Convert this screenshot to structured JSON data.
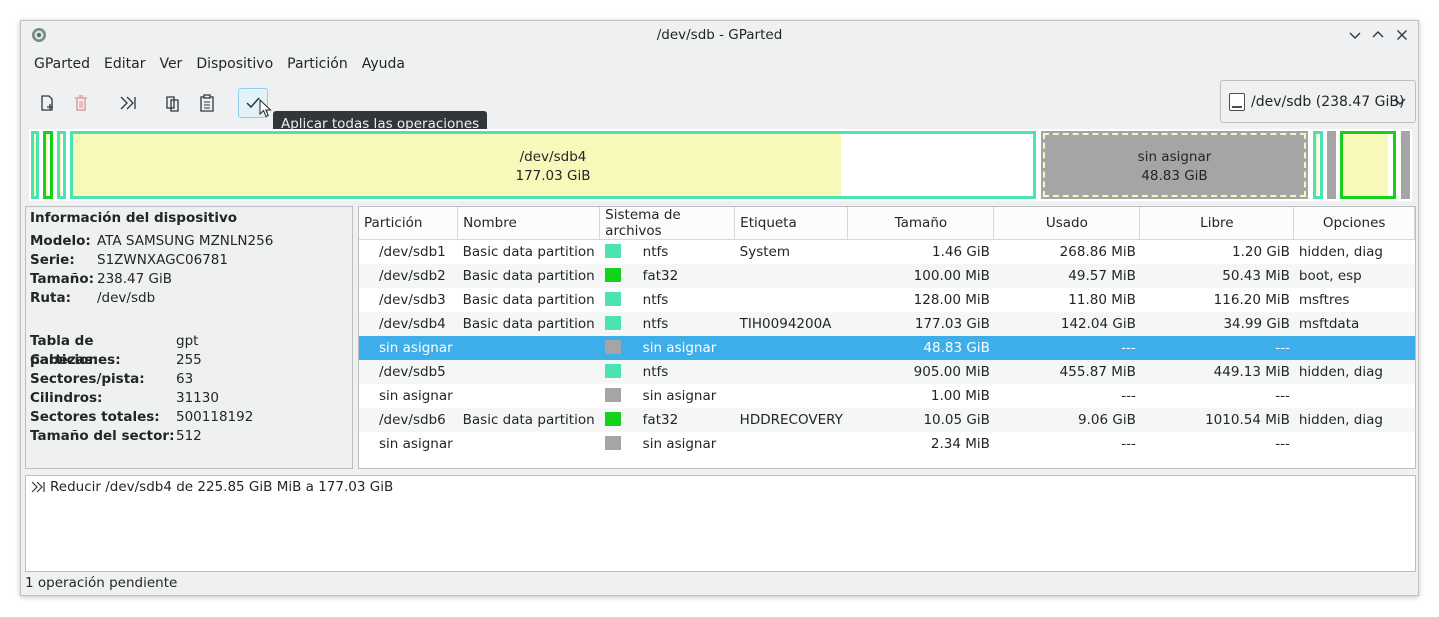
{
  "window": {
    "title": "/dev/sdb - GParted"
  },
  "menubar": [
    "GParted",
    "Editar",
    "Ver",
    "Dispositivo",
    "Partición",
    "Ayuda"
  ],
  "toolbar": {
    "buttons": [
      "new-icon",
      "delete-icon",
      "resize-move-icon",
      "copy-icon",
      "paste-icon",
      "apply-icon"
    ],
    "tooltip": "Aplicar todas las operaciones"
  },
  "device_selector": {
    "value": "/dev/sdb  (238.47 GiB)"
  },
  "disk_map": {
    "segments": [
      {
        "label": "",
        "fs": "ntfs",
        "used_fraction": 0.99,
        "border": "#4be3b0"
      },
      {
        "label": "",
        "fs": "fat32",
        "used_fraction": 0.5,
        "border": "#16d11a"
      },
      {
        "label": "",
        "fs": "ntfs",
        "used_fraction": 0.1,
        "border": "#4be3b0"
      },
      {
        "label": "/dev/sdb4",
        "size": "177.03 GiB",
        "fs": "ntfs",
        "used_fraction": 0.8,
        "border": "#4be3b0"
      },
      {
        "label": "sin asignar",
        "size": "48.83 GiB",
        "fs": "unallocated",
        "used_fraction": 1,
        "border": "#f8f8bb"
      },
      {
        "label": "",
        "fs": "ntfs",
        "used_fraction": 0.5,
        "border": "#4be3b0"
      },
      {
        "label": "",
        "fs": "unallocated",
        "used_fraction": 1,
        "border": "#a5a5a5"
      },
      {
        "label": "",
        "fs": "fat32",
        "used_fraction": 0.9,
        "border": "#16d11a"
      },
      {
        "label": "",
        "fs": "unallocated",
        "used_fraction": 1,
        "border": "#a5a5a5"
      }
    ]
  },
  "device_info": {
    "header": "Información del dispositivo",
    "rows1": [
      {
        "k": "Modelo:",
        "v": "ATA SAMSUNG MZNLN256"
      },
      {
        "k": "Serie:",
        "v": "S1ZWNXAGC06781"
      },
      {
        "k": "Tamaño:",
        "v": "238.47 GiB"
      },
      {
        "k": "Ruta:",
        "v": "/dev/sdb"
      }
    ],
    "rows2": [
      {
        "k": "Tabla de particiones:",
        "v": "gpt"
      },
      {
        "k": "Cabezas:",
        "v": "255"
      },
      {
        "k": "Sectores/pista:",
        "v": "63"
      },
      {
        "k": "Cilindros:",
        "v": "31130"
      },
      {
        "k": "Sectores totales:",
        "v": "500118192"
      },
      {
        "k": "Tamaño del sector:",
        "v": "512"
      }
    ]
  },
  "table": {
    "headers": [
      "Partición",
      "Nombre",
      "Sistema de archivos",
      "Etiqueta",
      "Tamaño",
      "Usado",
      "Libre",
      "Opciones"
    ],
    "rows": [
      {
        "part": "/dev/sdb1",
        "name": "Basic data partition",
        "fscolor": "#4be3b0",
        "fs": "ntfs",
        "label": "System",
        "size": "1.46 GiB",
        "used": "268.86 MiB",
        "free": "1.20 GiB",
        "flags": "hidden, diag"
      },
      {
        "part": "/dev/sdb2",
        "name": "Basic data partition",
        "fscolor": "#16d11a",
        "fs": "fat32",
        "label": "",
        "size": "100.00 MiB",
        "used": "49.57 MiB",
        "free": "50.43 MiB",
        "flags": "boot, esp"
      },
      {
        "part": "/dev/sdb3",
        "name": "Basic data partition",
        "fscolor": "#4be3b0",
        "fs": "ntfs",
        "label": "",
        "size": "128.00 MiB",
        "used": "11.80 MiB",
        "free": "116.20 MiB",
        "flags": "msftres"
      },
      {
        "part": "/dev/sdb4",
        "name": "Basic data partition",
        "fscolor": "#4be3b0",
        "fs": "ntfs",
        "label": "TIH0094200A",
        "size": "177.03 GiB",
        "used": "142.04 GiB",
        "free": "34.99 GiB",
        "flags": "msftdata"
      },
      {
        "part": "sin asignar",
        "name": "",
        "fscolor": "#a5a5a5",
        "fs": "sin asignar",
        "label": "",
        "size": "48.83 GiB",
        "used": "---",
        "free": "---",
        "flags": "",
        "selected": true
      },
      {
        "part": "/dev/sdb5",
        "name": "",
        "fscolor": "#4be3b0",
        "fs": "ntfs",
        "label": "",
        "size": "905.00 MiB",
        "used": "455.87 MiB",
        "free": "449.13 MiB",
        "flags": "hidden, diag"
      },
      {
        "part": "sin asignar",
        "name": "",
        "fscolor": "#a5a5a5",
        "fs": "sin asignar",
        "label": "",
        "size": "1.00 MiB",
        "used": "---",
        "free": "---",
        "flags": ""
      },
      {
        "part": "/dev/sdb6",
        "name": "Basic data partition",
        "fscolor": "#16d11a",
        "fs": "fat32",
        "label": "HDDRECOVERY",
        "size": "10.05 GiB",
        "used": "9.06 GiB",
        "free": "1010.54 MiB",
        "flags": "hidden, diag"
      },
      {
        "part": "sin asignar",
        "name": "",
        "fscolor": "#a5a5a5",
        "fs": "sin asignar",
        "label": "",
        "size": "2.34 MiB",
        "used": "---",
        "free": "---",
        "flags": ""
      }
    ]
  },
  "operations": [
    "Reducir /dev/sdb4 de 225.85 GiB MiB a 177.03 GiB"
  ],
  "statusbar": "1 operación pendiente",
  "colors": {
    "ntfs": "#4be3b0",
    "fat32": "#16d11a",
    "unallocated": "#a5a5a5",
    "used": "#f8f8bb",
    "selection": "#3daee9"
  }
}
